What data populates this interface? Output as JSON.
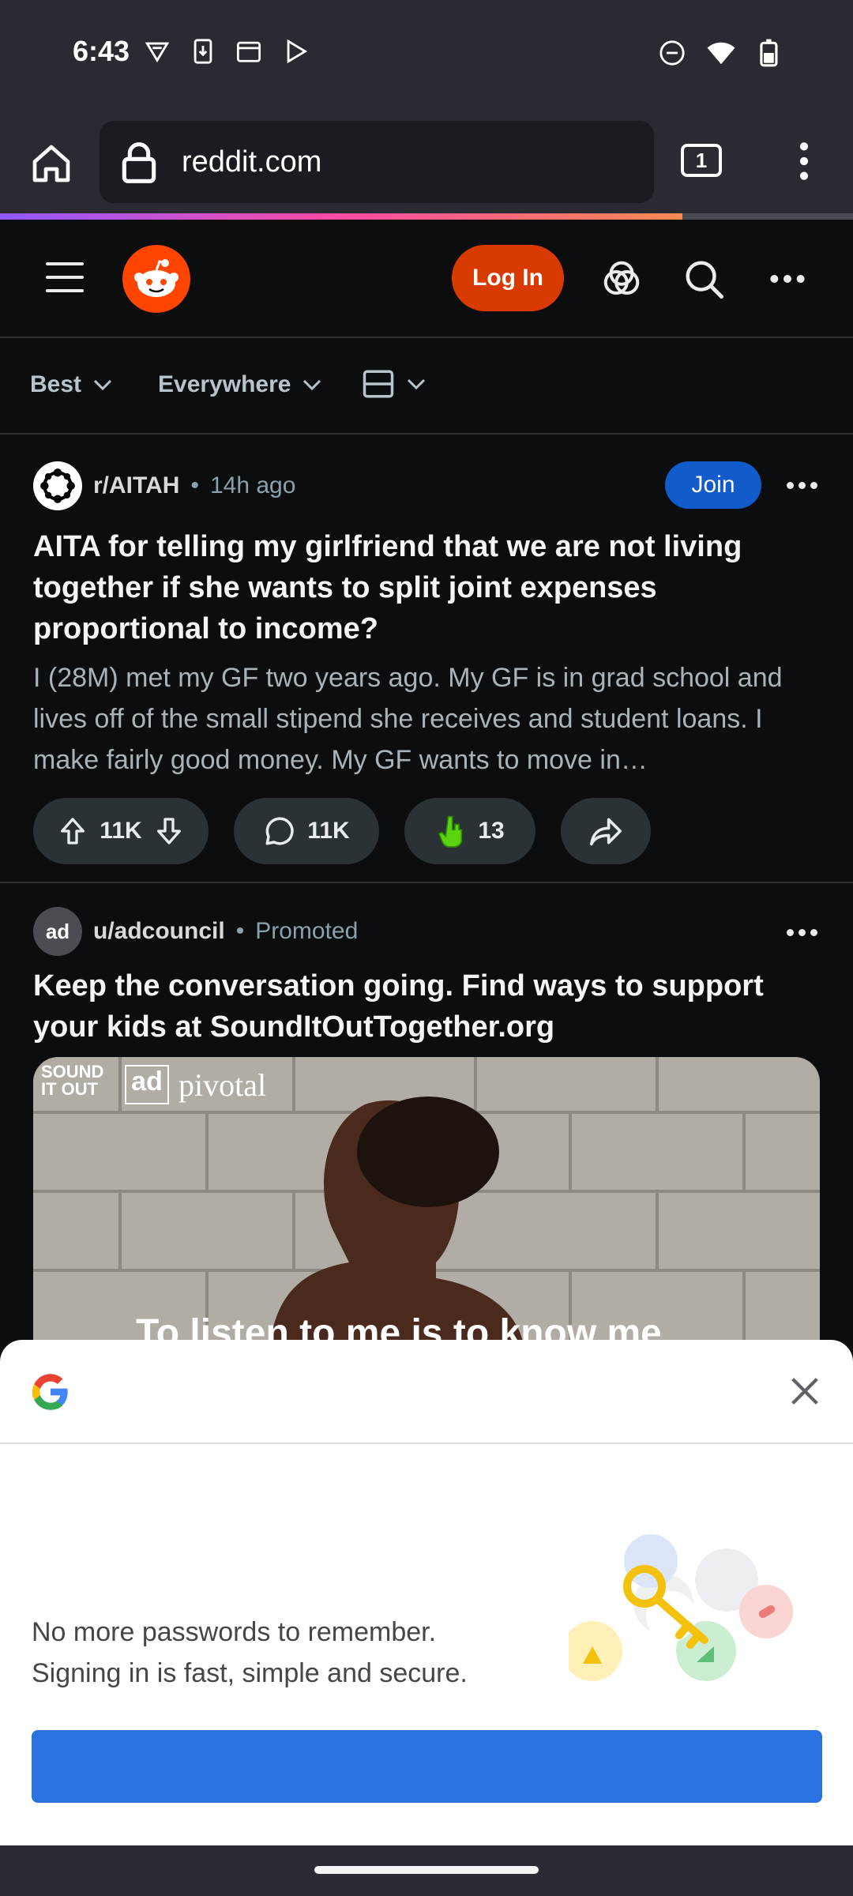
{
  "status": {
    "time": "6:43"
  },
  "browser": {
    "url": "reddit.com",
    "tab_count": "1",
    "load_progress_percent": 80
  },
  "header": {
    "login_label": "Log In"
  },
  "filters": {
    "sort": "Best",
    "scope": "Everywhere"
  },
  "post": {
    "subreddit": "r/AITAH",
    "separator": "•",
    "time": "14h ago",
    "join_label": "Join",
    "title": "AITA for telling my girlfriend that we are not living together if she wants to split joint expenses proportional to income?",
    "body": "I (28M) met my GF two years ago. My GF is in grad school and lives off of the small stipend she receives and student loans. I make fairly good money. My GF wants to move in…",
    "votes": "11K",
    "comments": "11K",
    "awards": "13"
  },
  "ad": {
    "avatar_text": "ad",
    "user": "u/adcouncil",
    "separator": "•",
    "label": "Promoted",
    "title": "Keep the conversation going. Find ways to support your kids at SoundItOutTogether.org",
    "media_logo_1": "SOUND IT OUT",
    "media_logo_2": "ad",
    "media_logo_3": "pivotal",
    "caption": "To listen to me is to know me"
  },
  "google_sheet": {
    "line1": "No more passwords to remember.",
    "line2": "Signing in is fast, simple and secure."
  },
  "colors": {
    "accent": "#ff4500",
    "join": "#115bca",
    "login": "#d93a00",
    "google_button": "#2a72e0"
  },
  "icons": [
    "home-icon",
    "lock-icon",
    "tabs-icon",
    "menu-icon",
    "hamburger-icon",
    "reddit-logo-icon",
    "popular-icon",
    "search-icon",
    "more-icon",
    "upvote-icon",
    "downvote-icon",
    "comment-icon",
    "award-icon",
    "share-icon",
    "google-icon",
    "close-icon"
  ]
}
